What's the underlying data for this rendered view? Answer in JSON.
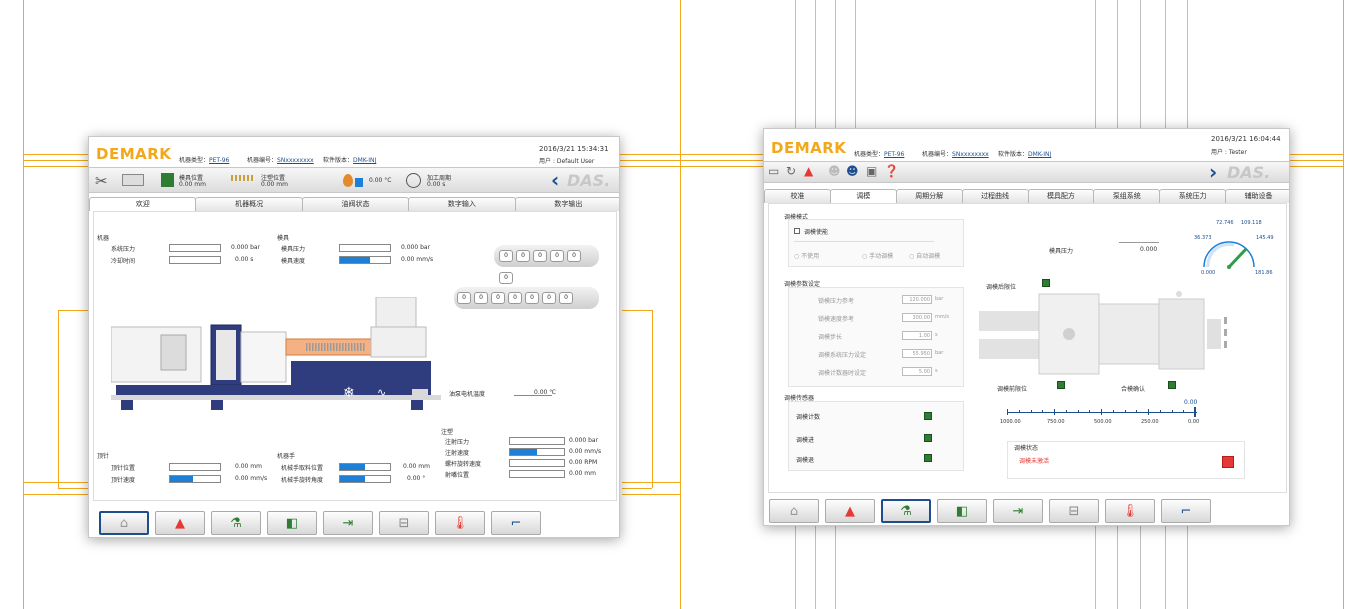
{
  "brand": {
    "name": "DEMARK",
    "slogan": "DAS."
  },
  "colors": {
    "accent": "#f3a81c",
    "progress": "#1e7fd6",
    "navy": "#2f3d7f",
    "alarm": "#e53935",
    "led": "#2e7d32"
  },
  "left": {
    "header": {
      "type_label": "机器类型：",
      "type_value": "PET-96",
      "sn_label": "机器编号：",
      "sn_value": "SNxxxxxxxx",
      "sw_label": "软件版本：",
      "sw_value": "DMK-INJ",
      "datetime": "2016/3/21 15:34:31",
      "user": "用户 : Default User"
    },
    "status": {
      "mold_pos_label": "模具位置",
      "mold_pos_value": "0.00 mm",
      "inj_pos_label": "注塑位置",
      "inj_pos_value": "0.00 mm",
      "temp_value": "0.00 °C",
      "cycle_label": "加工周期",
      "cycle_value": "0.00 s"
    },
    "tabs": [
      "欢迎",
      "机器概况",
      "油阀状态",
      "数字输入",
      "数字输出"
    ],
    "machine": {
      "title": "机器",
      "pressure_label": "系统压力",
      "pressure_value": "0.000 bar",
      "cool_label": "冷却时间",
      "cool_value": "0.00 s"
    },
    "mold": {
      "title": "模具",
      "pressure_label": "模具压力",
      "pressure_value": "0.000 bar",
      "speed_label": "模具速度",
      "speed_value": "0.00 mm/s"
    },
    "slots_top": [
      "0",
      "0",
      "0",
      "0",
      "0"
    ],
    "slots_mid": [
      "0"
    ],
    "slots_bot": [
      "0",
      "0",
      "0",
      "0",
      "0",
      "0",
      "0"
    ],
    "oil_temp_label": "油泵电机温度",
    "oil_temp_value": "0.00 ℃",
    "ejector": {
      "title": "顶针",
      "pos_label": "顶针位置",
      "pos_value": "0.00 mm",
      "speed_label": "顶针速度",
      "speed_value": "0.00 mm/s"
    },
    "robot": {
      "title": "机器手",
      "take_label": "机械手取料位置",
      "take_value": "0.00 mm",
      "angle_label": "机械手旋转角度",
      "angle_value": "0.00 °"
    },
    "injection": {
      "title": "注塑",
      "rows": [
        {
          "label": "注射压力",
          "value": "0.000 bar"
        },
        {
          "label": "注射速度",
          "value": "0.00 mm/s"
        },
        {
          "label": "螺杆旋转速度",
          "value": "0.00 RPM"
        },
        {
          "label": "射嘴位置",
          "value": "0.00 mm"
        }
      ]
    }
  },
  "right": {
    "header": {
      "type_label": "机器类型：",
      "type_value": "PET-96",
      "sn_label": "机器编号：",
      "sn_value": "SNxxxxxxxx",
      "sw_label": "软件版本：",
      "sw_value": "DMK-INJ",
      "datetime": "2016/3/21 16:04:44",
      "user": "用户 : Tester"
    },
    "tabs": [
      "校准",
      "调模",
      "周期分解",
      "过程曲线",
      "模具配方",
      "泵组系统",
      "系统压力",
      "辅助设备"
    ],
    "mode": {
      "title": "调模模式",
      "check_label": "调模使能",
      "opt1": "不使用",
      "opt2": "手动调模",
      "opt3": "自动调模"
    },
    "params": {
      "title": "调模参数设定",
      "rows": [
        {
          "label": "锁模压力参考",
          "value": "120.000",
          "unit": "bar"
        },
        {
          "label": "锁模速度参考",
          "value": "300.00",
          "unit": "mm/s"
        },
        {
          "label": "调模步长",
          "value": "1.00",
          "unit": "s"
        },
        {
          "label": "调模系统压力设定",
          "value": "55.950",
          "unit": "bar"
        },
        {
          "label": "调模计数器时设定",
          "value": "5.00",
          "unit": "s"
        }
      ]
    },
    "sensor": {
      "title": "调模传感器",
      "counter_label": "调模计数",
      "fwd_label": "调模进",
      "back_label": "调模退"
    },
    "mold_pressure_label": "模具压力",
    "mold_pressure_value": "0.000",
    "gauge": {
      "v1": "72.746",
      "v2": "109.118",
      "v3": "36.373",
      "v4": "145.49",
      "v5": "0.000",
      "v6": "181.86"
    },
    "back_limit_label": "调模后限位",
    "front_limit_label": "调模前限位",
    "lock_confirm_label": "合模确认",
    "ruler": {
      "value": "0.00",
      "ticks": [
        "1000.00",
        "750.00",
        "500.00",
        "250.00",
        "0.00"
      ]
    },
    "state": {
      "title": "调模状态",
      "value": "调模未激活"
    }
  }
}
